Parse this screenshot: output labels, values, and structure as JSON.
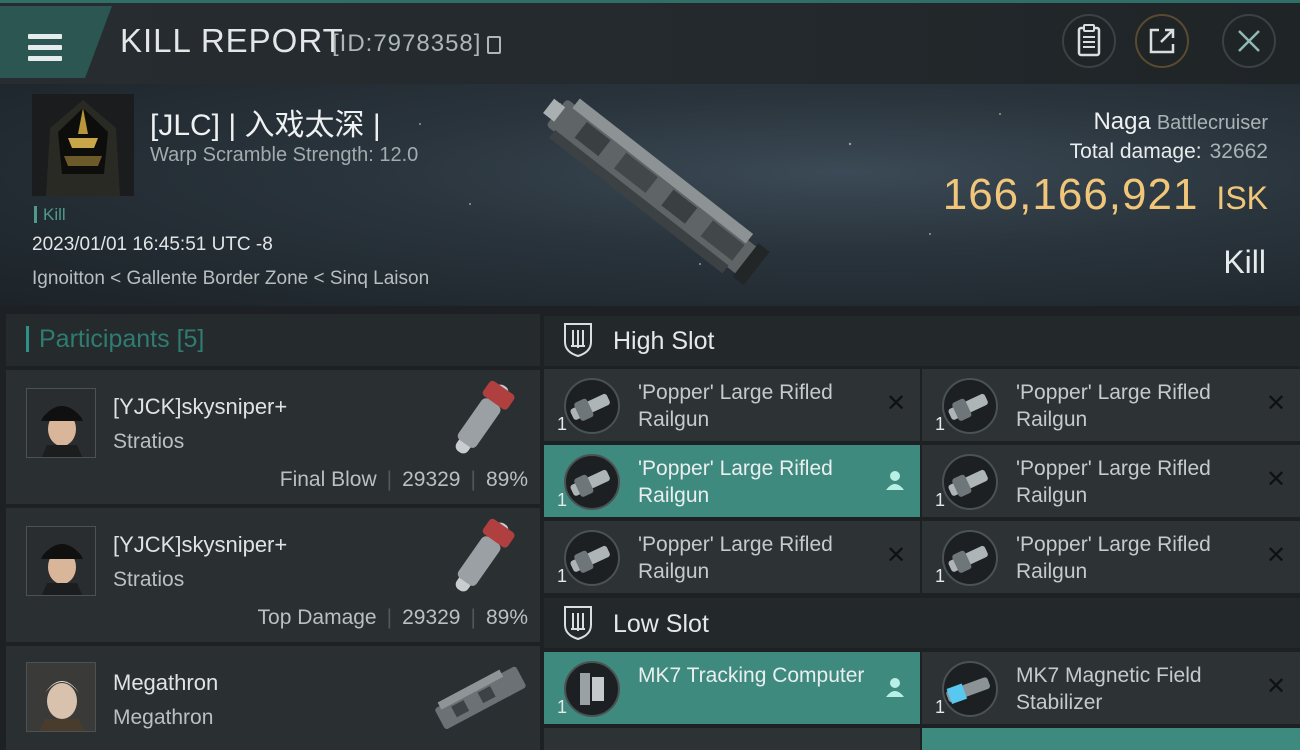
{
  "header": {
    "title": "KILL REPORT",
    "report_id": "[ID:7978358]",
    "icons": [
      "menu-icon",
      "copy-icon",
      "clipboard-icon",
      "share-icon",
      "close-icon"
    ]
  },
  "victim": {
    "name": "[JLC] | 入戏太深 |",
    "warp_scramble": "Warp Scramble Strength: 12.0",
    "tag": "Kill",
    "timestamp": "2023/01/01 16:45:51 UTC -8",
    "location": "Ignoitton < Gallente Border Zone < Sinq Laison"
  },
  "summary": {
    "ship_name": "Naga",
    "ship_class": "Battlecruiser",
    "damage_label": "Total damage:",
    "damage_value": "32662",
    "isk_value": "166,166,921",
    "isk_unit": "ISK",
    "status": "Kill"
  },
  "participants": {
    "title": "Participants",
    "count": "[5]",
    "rows": [
      {
        "name": "[YJCK]skysniper+",
        "ship": "Stratios",
        "role": "Final Blow",
        "damage": "29329",
        "percent": "89%"
      },
      {
        "name": "[YJCK]skysniper+",
        "ship": "Stratios",
        "role": "Top Damage",
        "damage": "29329",
        "percent": "89%"
      },
      {
        "name": "Megathron",
        "ship": "Megathron",
        "role": "",
        "damage": "",
        "percent": ""
      }
    ]
  },
  "high_slot": {
    "title": "High Slot",
    "modules": [
      {
        "name": "'Popper' Large Rifled Railgun",
        "qty": "1",
        "state": "destroyed"
      },
      {
        "name": "'Popper' Large Rifled Railgun",
        "qty": "1",
        "state": "destroyed"
      },
      {
        "name": "'Popper' Large Rifled Railgun",
        "qty": "1",
        "state": "dropped"
      },
      {
        "name": "'Popper' Large Rifled Railgun",
        "qty": "1",
        "state": "destroyed"
      },
      {
        "name": "'Popper' Large Rifled Railgun",
        "qty": "1",
        "state": "destroyed"
      },
      {
        "name": "'Popper' Large Rifled Railgun",
        "qty": "1",
        "state": "destroyed"
      }
    ]
  },
  "low_slot": {
    "title": "Low Slot",
    "modules": [
      {
        "name": "MK7 Tracking Computer",
        "qty": "1",
        "state": "dropped"
      },
      {
        "name": "MK7 Magnetic Field Stabilizer",
        "qty": "1",
        "state": "destroyed"
      }
    ]
  },
  "colors": {
    "accent": "#3f8a7e",
    "isk": "#f0c67a",
    "teal_text": "#2f7c72"
  }
}
